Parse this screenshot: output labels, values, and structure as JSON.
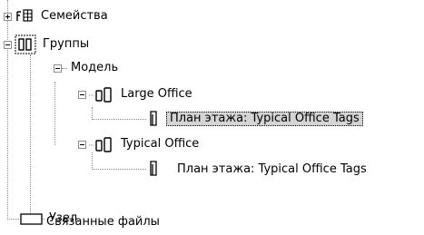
{
  "tree": {
    "families": {
      "label": "Семейства",
      "expanded": false,
      "icon": "families-icon"
    },
    "groups": {
      "label": "Группы",
      "expanded": true,
      "icon": "group-icon",
      "model": {
        "label": "Модель",
        "expanded": true,
        "items": [
          {
            "label": "Large Office",
            "expanded": true,
            "icon": "model-group-icon",
            "child": {
              "label": "План этажа: Typical Office Tags",
              "icon": "view-icon",
              "selected": true
            }
          },
          {
            "label": "Typical Office",
            "expanded": true,
            "icon": "model-group-icon",
            "child": {
              "label": "План этажа: Typical Office Tags",
              "icon": "view-icon",
              "selected": false
            }
          }
        ]
      },
      "detail": {
        "label": "Узел"
      }
    },
    "linked_files": {
      "label": "Связанные файлы",
      "icon": "linked-file-icon"
    }
  },
  "colors": {
    "selection": "#d4d4d4",
    "connector": "#8a8a8a"
  }
}
